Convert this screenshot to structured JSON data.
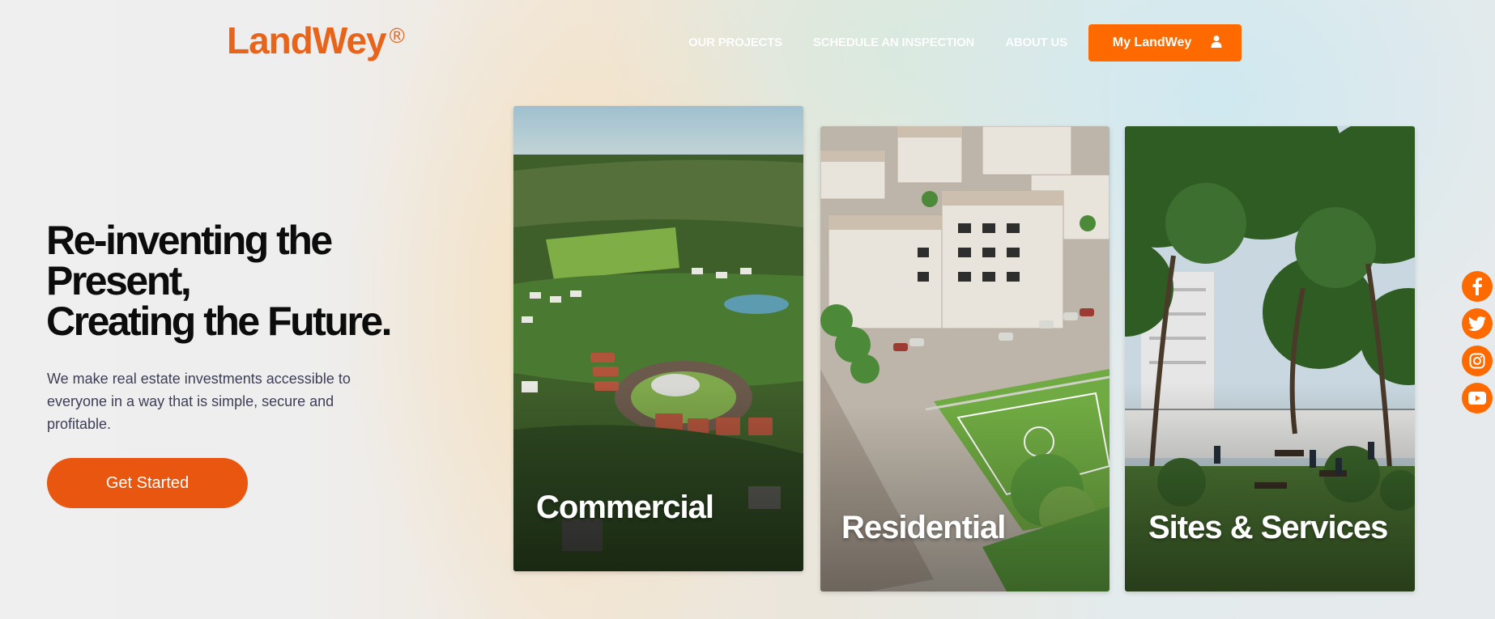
{
  "brand": {
    "name": "LandWey",
    "registered_mark": "®",
    "color": "#e8641b"
  },
  "nav": {
    "items": [
      {
        "label": "OUR PROJECTS"
      },
      {
        "label": "SCHEDULE AN INSPECTION"
      },
      {
        "label": "ABOUT US"
      }
    ],
    "account_button": {
      "label": "My LandWey",
      "icon": "user-icon",
      "color": "#fe6a00"
    }
  },
  "hero": {
    "title_lines": [
      "Re-inventing the",
      "Present,",
      "Creating the Future."
    ],
    "subtitle": "We make real estate investments accessible to everyone in a way that is simple, secure and profitable.",
    "cta_label": "Get Started",
    "cta_color": "#e8560f"
  },
  "cards": [
    {
      "label": "Commercial"
    },
    {
      "label": "Residential"
    },
    {
      "label": "Sites & Services"
    }
  ],
  "social": [
    {
      "icon": "facebook-icon"
    },
    {
      "icon": "twitter-icon"
    },
    {
      "icon": "instagram-icon"
    },
    {
      "icon": "youtube-icon"
    }
  ]
}
